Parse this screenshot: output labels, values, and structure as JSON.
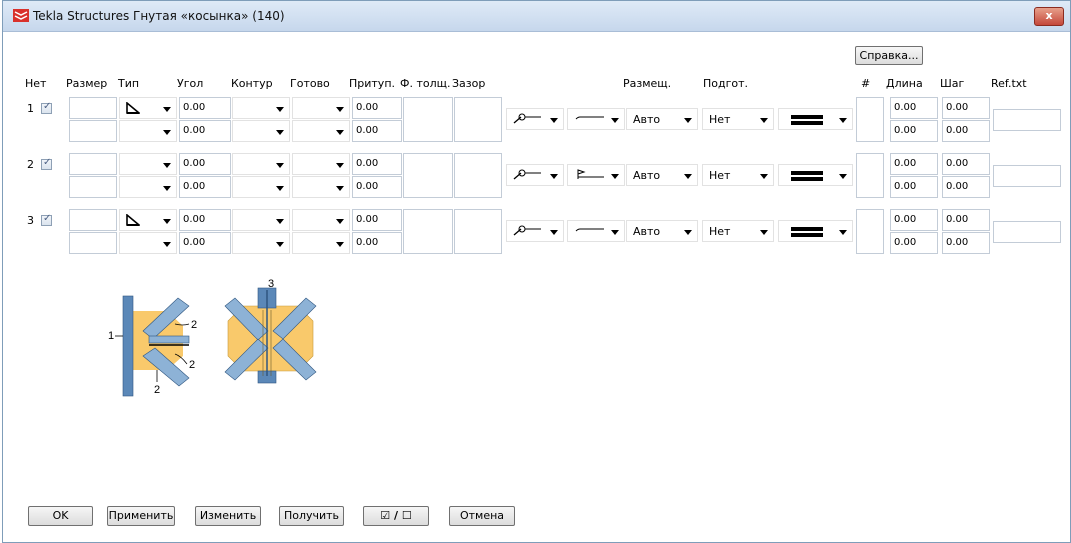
{
  "window": {
    "title": "Tekla Structures  Гнутая «косынка» (140)",
    "close_label": "x"
  },
  "help_label": "Справка...",
  "headers": {
    "none": "Нет",
    "size": "Размер",
    "type": "Тип",
    "angle": "Угол",
    "contour": "Контур",
    "finish": "Готово",
    "prep": "Притуп.",
    "eff_thick": "Ф. толщ.",
    "gap": "Зазор",
    "placement": "Размещ.",
    "preparation": "Подгот.",
    "number": "#",
    "length": "Длина",
    "pitch": "Шаг",
    "reftext": "Ref.txt"
  },
  "rows": [
    {
      "num": "1",
      "angle_top": "0.00",
      "angle_bottom": "0.00",
      "prep_top": "0.00",
      "prep_bottom": "0.00",
      "placement": "Авто",
      "preparation": "Нет",
      "length_top": "0.00",
      "length_bottom": "0.00",
      "pitch_top": "0.00",
      "pitch_bottom": "0.00"
    },
    {
      "num": "2",
      "angle_top": "0.00",
      "angle_bottom": "0.00",
      "prep_top": "0.00",
      "prep_bottom": "0.00",
      "placement": "Авто",
      "preparation": "Нет",
      "length_top": "0.00",
      "length_bottom": "0.00",
      "pitch_top": "0.00",
      "pitch_bottom": "0.00"
    },
    {
      "num": "3",
      "angle_top": "0.00",
      "angle_bottom": "0.00",
      "prep_top": "0.00",
      "prep_bottom": "0.00",
      "placement": "Авто",
      "preparation": "Нет",
      "length_top": "0.00",
      "length_bottom": "0.00",
      "pitch_top": "0.00",
      "pitch_bottom": "0.00"
    }
  ],
  "diagram_labels": {
    "l1": "1",
    "l2a": "2",
    "l2b": "2",
    "l2c": "2",
    "l3": "3"
  },
  "buttons": {
    "ok": "OK",
    "apply": "Применить",
    "modify": "Изменить",
    "get": "Получить",
    "toggle": "☑ / ☐",
    "cancel": "Отмена"
  },
  "colors": {
    "plate": "#f9c96b",
    "member": "#5b88b8",
    "member_light": "#8db2d6"
  }
}
